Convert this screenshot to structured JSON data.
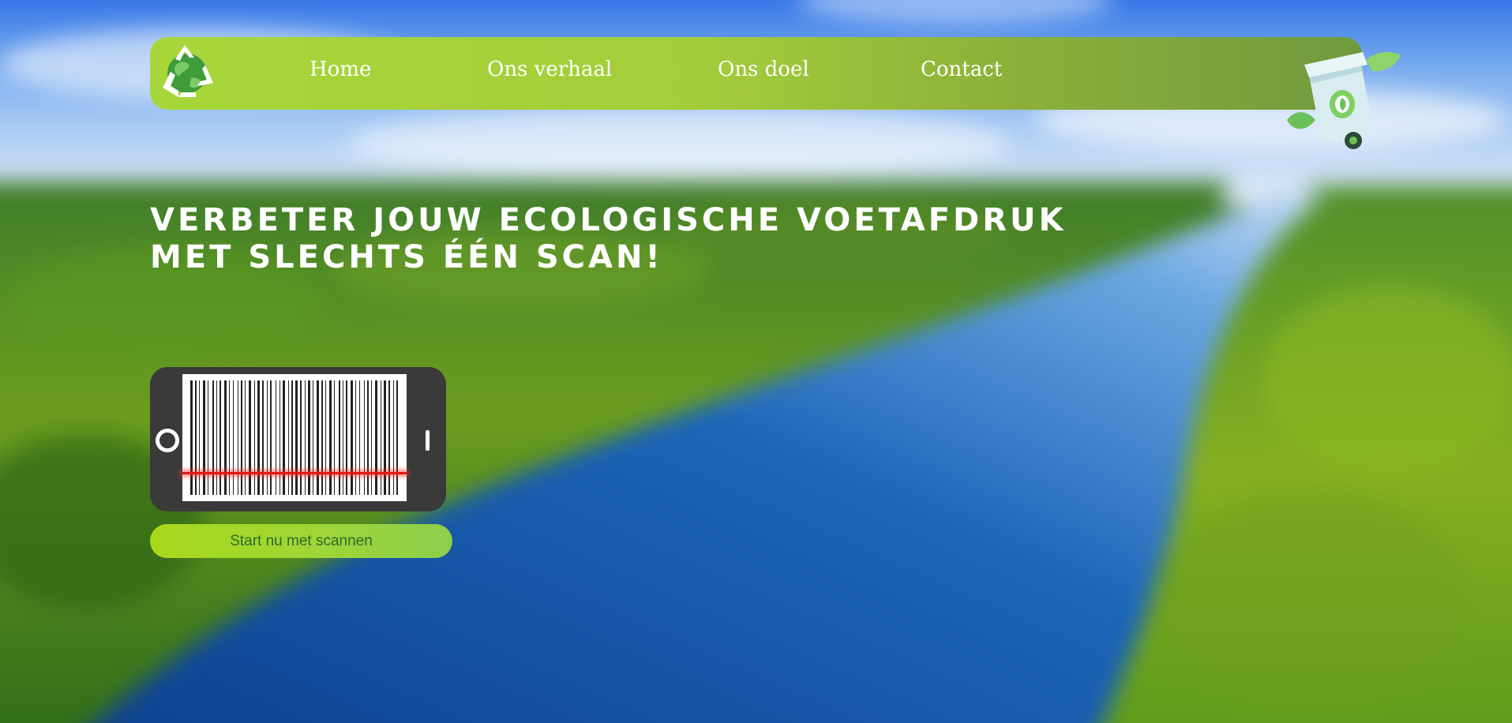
{
  "nav": {
    "logo_icon": "recycle-globe-icon",
    "items": [
      {
        "label": "Home"
      },
      {
        "label": "Ons verhaal"
      },
      {
        "label": "Ons doel"
      },
      {
        "label": "Contact"
      }
    ],
    "decoration_icon": "recycle-bin-icon"
  },
  "hero": {
    "headline_line1": "Verbeter jouw ecologische voetafdruk",
    "headline_line2": "met slechts één scan!",
    "scanner_icon": "phone-barcode-scanner-icon",
    "cta_label": "Start nu met scannen"
  },
  "colors": {
    "nav_green": "#a7d63a",
    "nav_green_dark": "#6f9a3e",
    "cta_text": "#2f6b2c",
    "scan_line": "#e01818",
    "sky": "#1c6fe8",
    "forest": "#3f8a1e",
    "river": "#1a5fae"
  }
}
